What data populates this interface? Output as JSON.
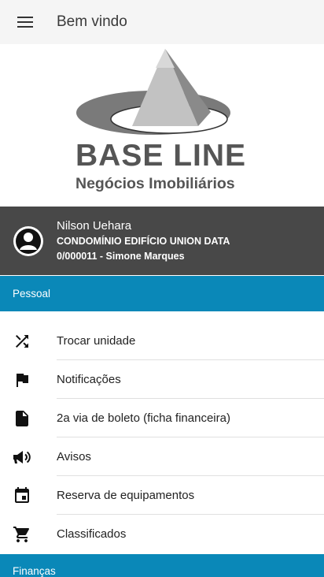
{
  "appbar": {
    "title": "Bem vindo",
    "menu_icon": "hamburger-menu-icon"
  },
  "logo": {
    "brand": "BASE LINE",
    "tagline": "Negócios Imobiliários"
  },
  "profile": {
    "name": "Nilson Uehara",
    "condominium": "CONDOMÍNIO EDIFÍCIO UNION DATA",
    "unit": "0/000011 - Simone Marques",
    "avatar_icon": "account-circle-icon"
  },
  "sections": {
    "pessoal": "Pessoal",
    "financas": "Finanças"
  },
  "menu": [
    {
      "label": "Trocar unidade",
      "icon": "shuffle-icon"
    },
    {
      "label": "Notificações",
      "icon": "flag-icon"
    },
    {
      "label": "2a via de boleto (ficha financeira)",
      "icon": "document-icon"
    },
    {
      "label": "Avisos",
      "icon": "megaphone-icon"
    },
    {
      "label": "Reserva de equipamentos",
      "icon": "calendar-event-icon"
    },
    {
      "label": "Classificados",
      "icon": "shopping-cart-icon"
    }
  ],
  "colors": {
    "section_bg": "#0a88b8",
    "profile_bg": "#484848",
    "appbar_bg": "#f5f5f5"
  }
}
